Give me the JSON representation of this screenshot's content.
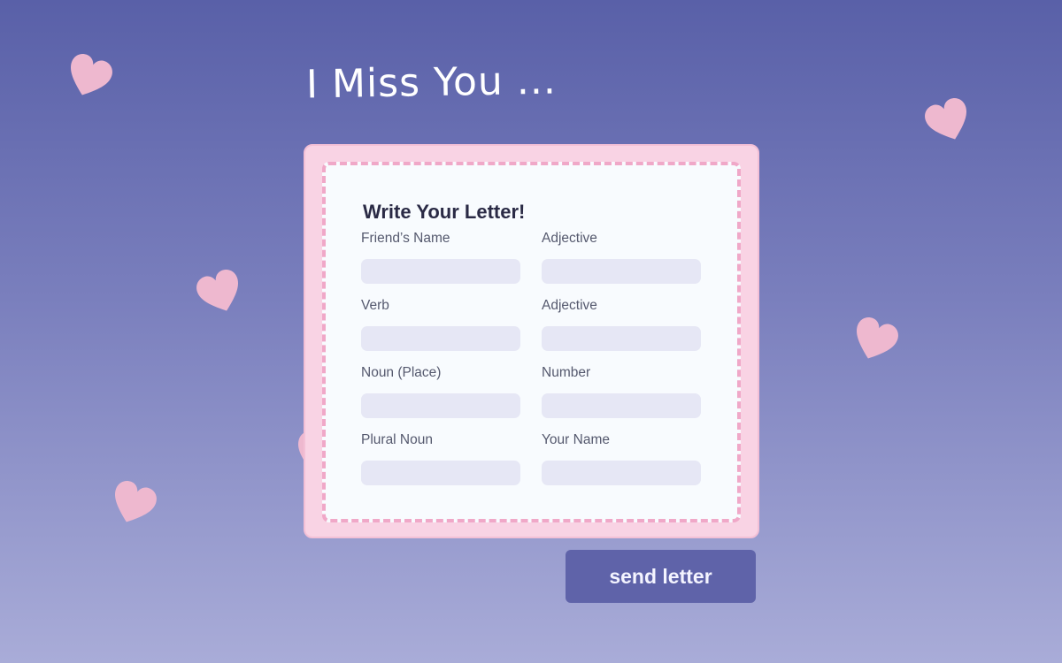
{
  "page": {
    "title": "I Miss You ..."
  },
  "form": {
    "heading": "Write Your Letter!",
    "fields": [
      {
        "label": "Friend’s Name",
        "value": ""
      },
      {
        "label": "Adjective",
        "value": ""
      },
      {
        "label": "Verb",
        "value": ""
      },
      {
        "label": "Adjective",
        "value": ""
      },
      {
        "label": "Noun (Place)",
        "value": ""
      },
      {
        "label": "Number",
        "value": ""
      },
      {
        "label": "Plural Noun",
        "value": ""
      },
      {
        "label": "Your Name",
        "value": ""
      }
    ]
  },
  "actions": {
    "send_label": "send letter"
  },
  "colors": {
    "background_top": "#5960a8",
    "background_bottom": "#a9acd8",
    "frame": "#f9d3e4",
    "dashed_border": "#f0a8c8",
    "input_fill": "#e6e7f5",
    "button": "#5f63a9",
    "heart": "#eeb8cf"
  },
  "decorations": {
    "icon": "heart-icon"
  }
}
